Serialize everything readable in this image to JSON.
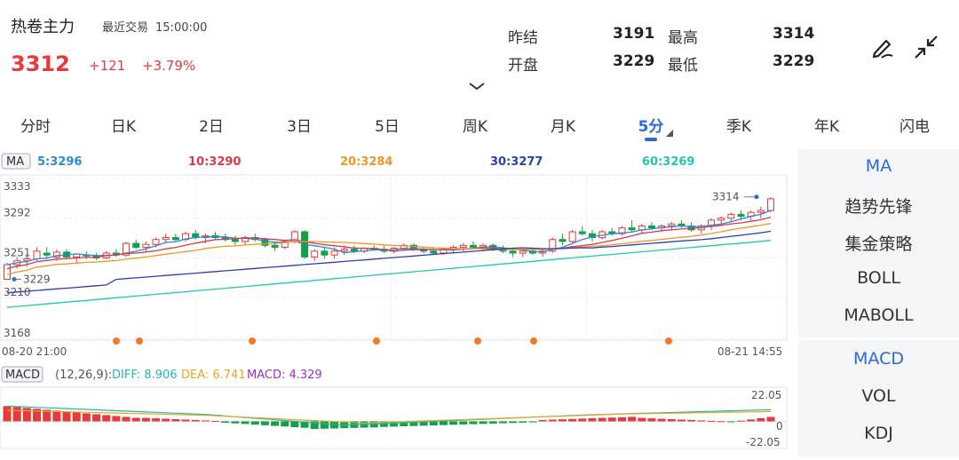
{
  "header": {
    "title": "热卷主力",
    "recent_label": "最近交易",
    "recent_time": "15:00:00",
    "price": "3312",
    "change": "+121",
    "change_pct": "+3.79%",
    "up_color": "#e8393b"
  },
  "stats": {
    "prev_close_label": "昨结",
    "prev_close": "3191",
    "high_label": "最高",
    "high": "3314",
    "open_label": "开盘",
    "open": "3229",
    "low_label": "最低",
    "low": "3229"
  },
  "icons": {
    "draw": "pen-draw-icon",
    "collapse": "collapse-arrows-icon",
    "expand": "chevron-down-icon"
  },
  "tabs": [
    "分时",
    "日K",
    "2日",
    "3日",
    "5日",
    "周K",
    "月K",
    "5分",
    "季K",
    "年K",
    "闪电"
  ],
  "active_tab": "5分",
  "ma": {
    "chip": "MA",
    "ma5": "5:3296",
    "ma10": "10:3290",
    "ma20": "20:3284",
    "ma30": "30:3277",
    "ma60": "60:3269",
    "colors": {
      "ma5": "#2a8ad8",
      "ma10": "#d83a4a",
      "ma20": "#f0962a",
      "ma30": "#2a40b0",
      "ma60": "#20c8b0"
    }
  },
  "price_axis": [
    "3333",
    "3292",
    "3251",
    "3210",
    "3168"
  ],
  "high_marker": "3314",
  "low_marker": "3229",
  "time_start": "08-20 21:00",
  "time_end": "08-21 14:55",
  "macd": {
    "chip": "MACD",
    "params": "(12,26,9):",
    "diff": "DIFF: 8.906",
    "dea": "DEA: 6.741",
    "macd": "MACD: 4.329",
    "axis_top": "22.05",
    "axis_mid": "0",
    "axis_bottom": "-22.05",
    "colors": {
      "diff": "#20b8b0",
      "dea": "#e8a520",
      "macd": "#9a30c8"
    }
  },
  "side_panel": {
    "group1": [
      "MA",
      "趋势先锋",
      "集金策略",
      "BOLL",
      "MABOLL"
    ],
    "group1_active": "MA",
    "group2": [
      "MACD",
      "VOL",
      "KDJ"
    ],
    "group2_active": "MACD"
  },
  "chart_data": {
    "type": "candlestick",
    "symbol": "热卷主力",
    "interval": "5分",
    "y_range": [
      3168,
      3333
    ],
    "y_ticks": [
      3333,
      3292,
      3251,
      3210,
      3168
    ],
    "x_range_labels": [
      "08-20 21:00",
      "08-21 14:55"
    ],
    "candles": [
      [
        3229,
        3246,
        3229,
        3244
      ],
      [
        3244,
        3252,
        3240,
        3248
      ],
      [
        3248,
        3255,
        3242,
        3250
      ],
      [
        3250,
        3262,
        3248,
        3258
      ],
      [
        3256,
        3262,
        3250,
        3254
      ],
      [
        3252,
        3260,
        3248,
        3257
      ],
      [
        3257,
        3260,
        3250,
        3252
      ],
      [
        3252,
        3256,
        3246,
        3255
      ],
      [
        3254,
        3258,
        3250,
        3253
      ],
      [
        3253,
        3256,
        3249,
        3251
      ],
      [
        3251,
        3258,
        3250,
        3256
      ],
      [
        3256,
        3260,
        3252,
        3254
      ],
      [
        3254,
        3268,
        3252,
        3266
      ],
      [
        3266,
        3270,
        3260,
        3262
      ],
      [
        3262,
        3268,
        3258,
        3265
      ],
      [
        3265,
        3272,
        3262,
        3270
      ],
      [
        3270,
        3276,
        3266,
        3272
      ],
      [
        3272,
        3276,
        3268,
        3270
      ],
      [
        3270,
        3278,
        3268,
        3276
      ],
      [
        3276,
        3280,
        3270,
        3272
      ],
      [
        3272,
        3276,
        3266,
        3274
      ],
      [
        3274,
        3278,
        3270,
        3272
      ],
      [
        3272,
        3276,
        3268,
        3270
      ],
      [
        3270,
        3274,
        3264,
        3268
      ],
      [
        3268,
        3274,
        3264,
        3272
      ],
      [
        3272,
        3276,
        3268,
        3270
      ],
      [
        3270,
        3272,
        3262,
        3264
      ],
      [
        3264,
        3268,
        3258,
        3262
      ],
      [
        3262,
        3270,
        3260,
        3268
      ],
      [
        3268,
        3280,
        3266,
        3278
      ],
      [
        3278,
        3280,
        3250,
        3252
      ],
      [
        3252,
        3260,
        3248,
        3258
      ],
      [
        3258,
        3262,
        3250,
        3254
      ],
      [
        3254,
        3262,
        3250,
        3258
      ],
      [
        3258,
        3264,
        3254,
        3260
      ],
      [
        3260,
        3264,
        3256,
        3258
      ],
      [
        3258,
        3262,
        3256,
        3261
      ],
      [
        3261,
        3264,
        3258,
        3260
      ],
      [
        3260,
        3264,
        3256,
        3258
      ],
      [
        3258,
        3262,
        3256,
        3261
      ],
      [
        3261,
        3266,
        3258,
        3264
      ],
      [
        3264,
        3266,
        3258,
        3260
      ],
      [
        3260,
        3262,
        3256,
        3258
      ],
      [
        3258,
        3262,
        3254,
        3256
      ],
      [
        3256,
        3262,
        3254,
        3260
      ],
      [
        3260,
        3264,
        3256,
        3262
      ],
      [
        3262,
        3266,
        3258,
        3264
      ],
      [
        3264,
        3268,
        3260,
        3262
      ],
      [
        3262,
        3266,
        3258,
        3264
      ],
      [
        3264,
        3266,
        3258,
        3260
      ],
      [
        3260,
        3264,
        3256,
        3258
      ],
      [
        3258,
        3262,
        3252,
        3256
      ],
      [
        3256,
        3260,
        3252,
        3258
      ],
      [
        3258,
        3262,
        3254,
        3256
      ],
      [
        3256,
        3260,
        3252,
        3258
      ],
      [
        3258,
        3272,
        3256,
        3270
      ],
      [
        3270,
        3276,
        3264,
        3268
      ],
      [
        3268,
        3280,
        3266,
        3278
      ],
      [
        3278,
        3284,
        3274,
        3276
      ],
      [
        3276,
        3280,
        3268,
        3272
      ],
      [
        3272,
        3280,
        3270,
        3278
      ],
      [
        3278,
        3282,
        3274,
        3276
      ],
      [
        3276,
        3284,
        3274,
        3282
      ],
      [
        3282,
        3290,
        3278,
        3280
      ],
      [
        3280,
        3286,
        3276,
        3284
      ],
      [
        3284,
        3288,
        3280,
        3282
      ],
      [
        3282,
        3286,
        3278,
        3284
      ],
      [
        3284,
        3288,
        3280,
        3286
      ],
      [
        3286,
        3290,
        3282,
        3284
      ],
      [
        3284,
        3288,
        3278,
        3280
      ],
      [
        3280,
        3286,
        3276,
        3284
      ],
      [
        3284,
        3292,
        3280,
        3290
      ],
      [
        3290,
        3294,
        3284,
        3292
      ],
      [
        3292,
        3298,
        3288,
        3296
      ],
      [
        3296,
        3300,
        3290,
        3294
      ],
      [
        3294,
        3300,
        3290,
        3298
      ],
      [
        3298,
        3304,
        3292,
        3300
      ],
      [
        3300,
        3314,
        3298,
        3312
      ]
    ],
    "ma_latest": {
      "MA5": 3296,
      "MA10": 3290,
      "MA20": 3284,
      "MA30": 3277,
      "MA60": 3269
    },
    "macd_latest": {
      "DIFF": 8.906,
      "DEA": 6.741,
      "MACD": 4.329
    },
    "macd_range": [
      -22.05,
      22.05
    ]
  }
}
